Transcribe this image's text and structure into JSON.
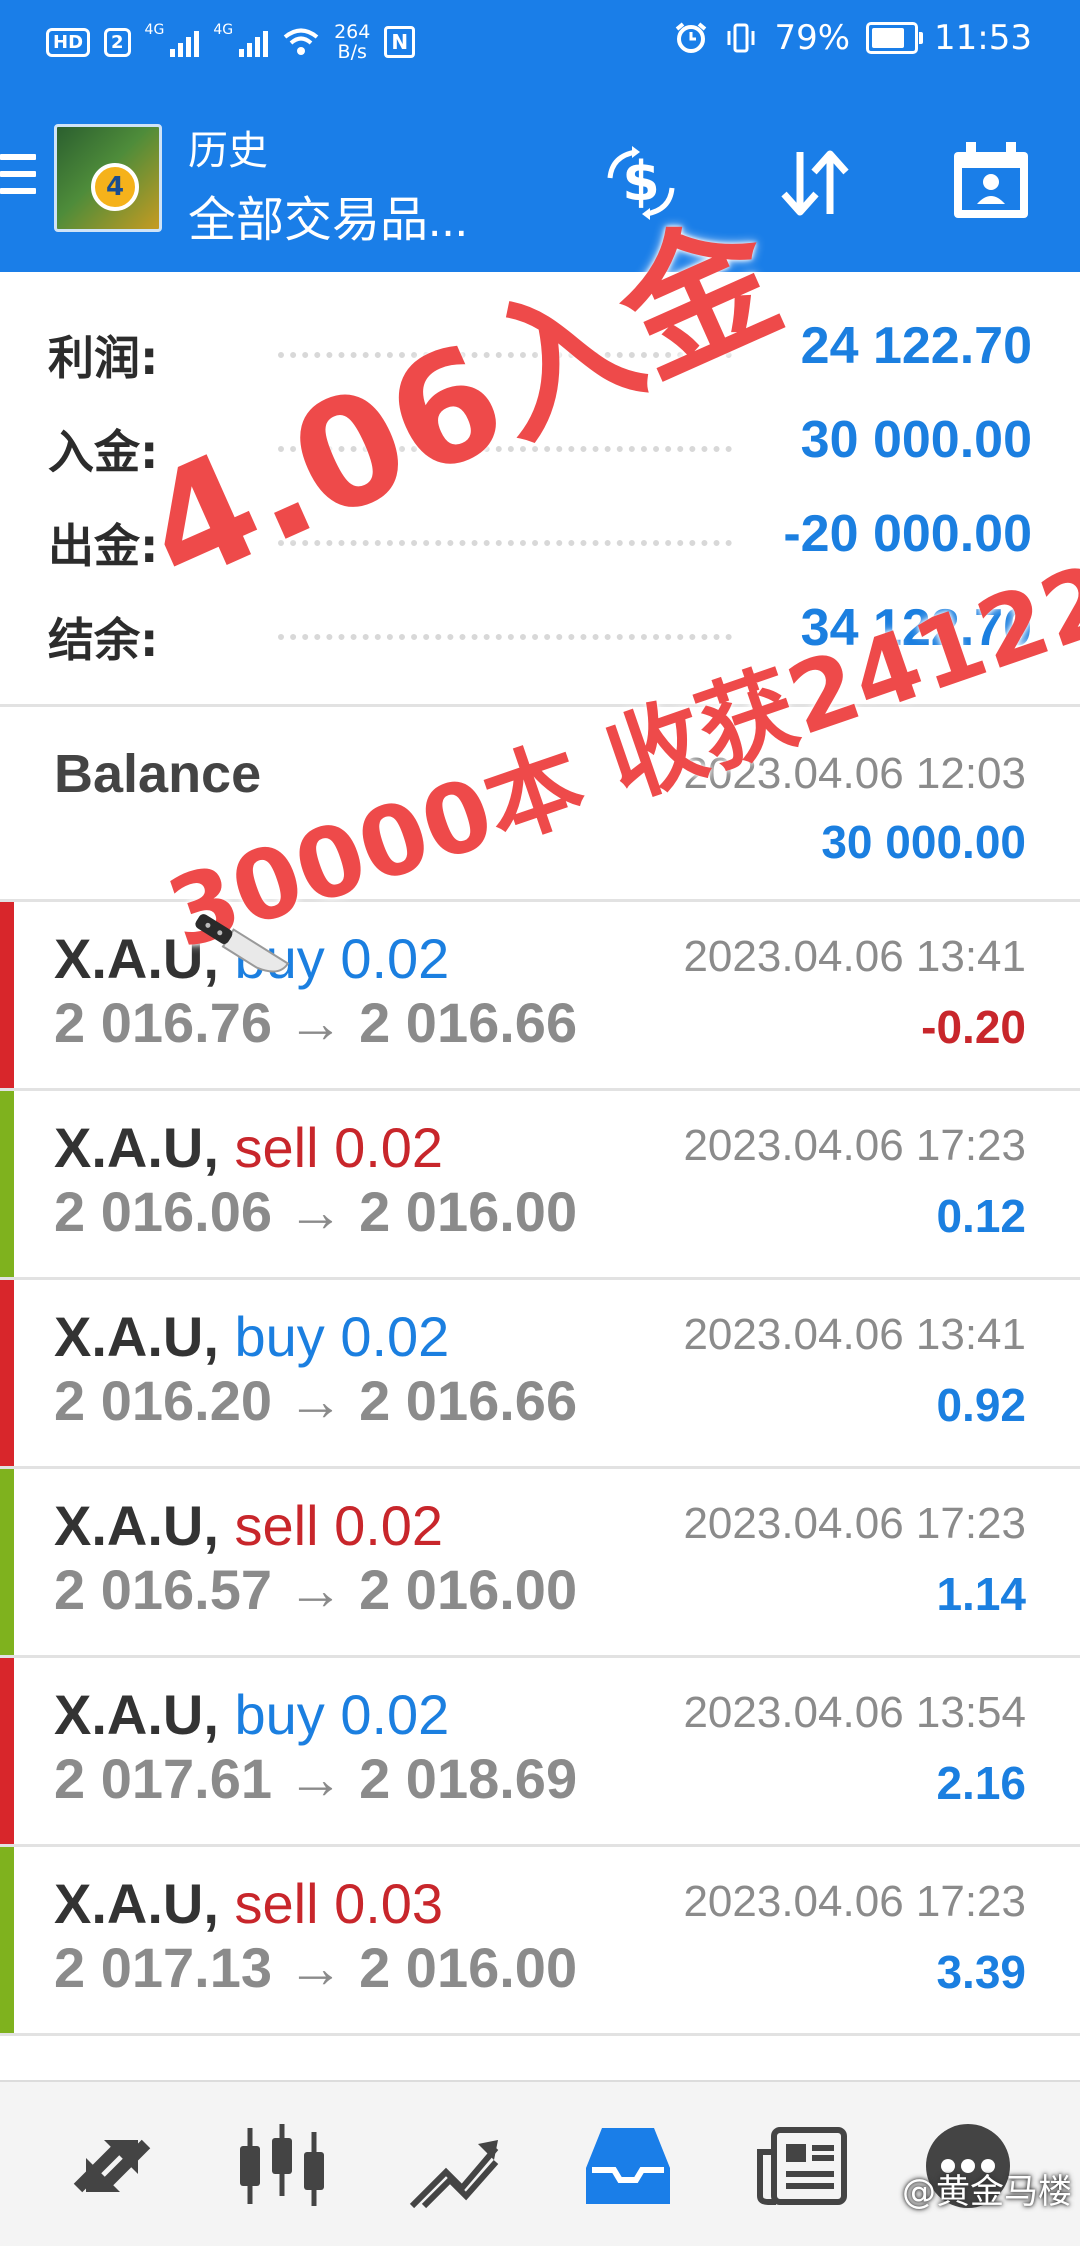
{
  "status_bar": {
    "chip_hd": "HD",
    "chip_num": "2",
    "net1": "4G",
    "net2": "4G",
    "speed_value": "264",
    "speed_unit": "B/s",
    "nfc": "N",
    "battery": "79%",
    "battery_level": 0.79,
    "time": "11:53"
  },
  "appbar": {
    "title": "历史",
    "subtitle": "全部交易品..."
  },
  "summary": {
    "rows": [
      {
        "label": "利润:",
        "value": "24 122.70"
      },
      {
        "label": "入金:",
        "value": "30 000.00"
      },
      {
        "label": "出金:",
        "value": "-20 000.00"
      },
      {
        "label": "结余:",
        "value": "34 122.70"
      }
    ]
  },
  "balance_row": {
    "label": "Balance",
    "datetime": "2023.04.06 12:03",
    "amount": "30 000.00"
  },
  "trades": [
    {
      "symbol": "X.A.U,",
      "type": "buy 0.02",
      "prices": "2 016.76 → 2 016.66",
      "datetime": "2023.04.06 13:41",
      "profit": "-0.20"
    },
    {
      "symbol": "X.A.U,",
      "type": "sell 0.02",
      "prices": "2 016.06 → 2 016.00",
      "datetime": "2023.04.06 17:23",
      "profit": "0.12"
    },
    {
      "symbol": "X.A.U,",
      "type": "buy 0.02",
      "prices": "2 016.20 → 2 016.66",
      "datetime": "2023.04.06 13:41",
      "profit": "0.92"
    },
    {
      "symbol": "X.A.U,",
      "type": "sell 0.02",
      "prices": "2 016.57 → 2 016.00",
      "datetime": "2023.04.06 17:23",
      "profit": "1.14"
    },
    {
      "symbol": "X.A.U,",
      "type": "buy 0.02",
      "prices": "2 017.61 → 2 018.69",
      "datetime": "2023.04.06 13:54",
      "profit": "2.16"
    },
    {
      "symbol": "X.A.U,",
      "type": "sell 0.03",
      "prices": "2 017.13 → 2 016.00",
      "datetime": "2023.04.06 17:23",
      "profit": "3.39"
    }
  ],
  "overlay": {
    "headline": "4.06入金",
    "subline": "30000本 收获24122",
    "credit": "@黄金马楼"
  },
  "colors": {
    "brand": "#1a7ee8",
    "buy": "#1b7fe0",
    "sell": "#c8262b",
    "buy_strip": "#d8262b",
    "sell_strip": "#7fb21e",
    "watermark": "#ee4a4a"
  },
  "bottom_nav": {
    "items": [
      "quotes-icon",
      "chart-icon",
      "trade-icon",
      "history-icon",
      "news-icon",
      "messages-icon"
    ],
    "active": "history-icon"
  }
}
